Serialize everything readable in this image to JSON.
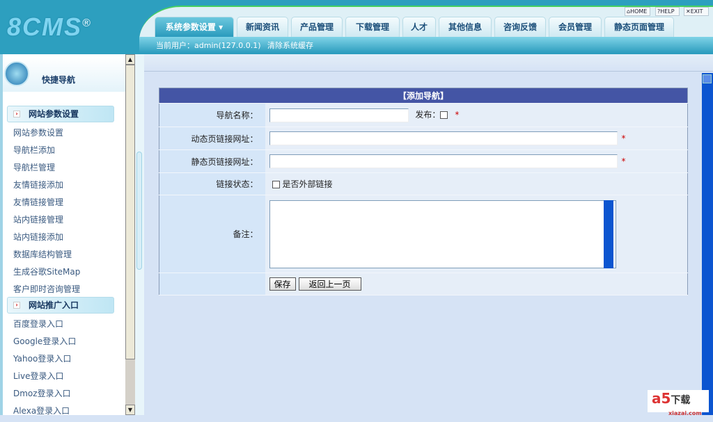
{
  "app": {
    "logo": "8CMS",
    "logo_mark": "®"
  },
  "tabs": [
    {
      "label": "系统参数设置 ▾",
      "active": true
    },
    {
      "label": "新闻资讯"
    },
    {
      "label": "产品管理"
    },
    {
      "label": "下载管理"
    },
    {
      "label": "人才"
    },
    {
      "label": "其他信息"
    },
    {
      "label": "咨询反馈"
    },
    {
      "label": "会员管理"
    },
    {
      "label": "静态页面管理"
    }
  ],
  "toolbar": {
    "home": "HOME",
    "help": "HELP",
    "exit": "EXIT"
  },
  "subbar": {
    "user": "当前用户：admin(127.0.0.1)",
    "clear_cache": "清除系统缓存"
  },
  "sidebar": {
    "title": "快捷导航",
    "sections": [
      {
        "title": "网站参数设置",
        "items": [
          "网站参数设置",
          "导航栏添加",
          "导航栏管理",
          "友情链接添加",
          "友情链接管理",
          "站内链接管理",
          "站内链接添加",
          "数据库结构管理",
          "生成谷歌SiteMap",
          "客户即时咨询管理"
        ]
      },
      {
        "title": "网站推广入口",
        "items": [
          "百度登录入口",
          "Google登录入口",
          "Yahoo登录入口",
          "Live登录入口",
          "Dmoz登录入口",
          "Alexa登录入口"
        ]
      }
    ]
  },
  "form": {
    "title": "【添加导航】",
    "name_label": "导航名称：",
    "publish_label": "发布：",
    "required": "*",
    "dynamic_label": "动态页链接网址：",
    "static_label": "静态页链接网址：",
    "status_label": "链接状态：",
    "external_label": "是否外部链接",
    "remark_label": "备注：",
    "save": "保存",
    "back": "返回上一页"
  },
  "watermark": {
    "brand": "a5",
    "text": "下载",
    "url": "xiazai.com"
  }
}
